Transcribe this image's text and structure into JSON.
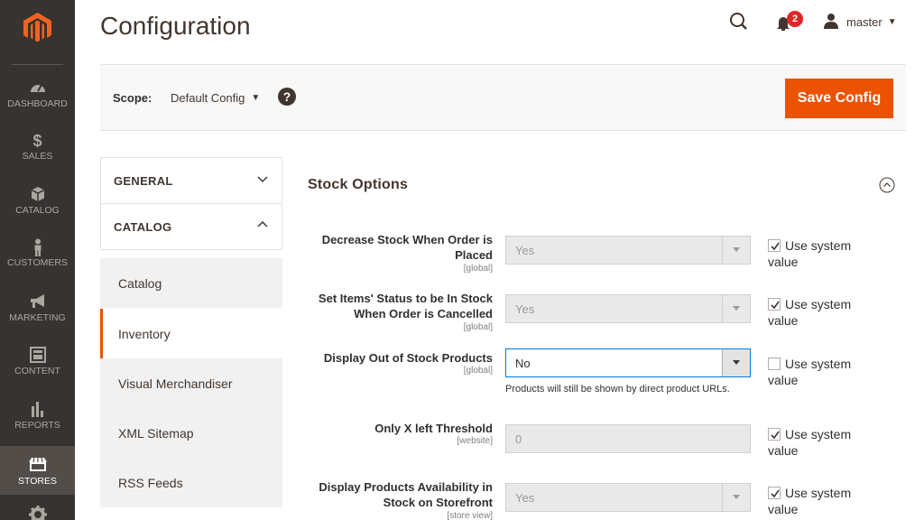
{
  "nav": {
    "items": [
      {
        "key": "dashboard",
        "label": "DASHBOARD",
        "icon": "speedometer-icon"
      },
      {
        "key": "sales",
        "label": "SALES",
        "icon": "dollar-icon"
      },
      {
        "key": "catalog",
        "label": "CATALOG",
        "icon": "box-icon"
      },
      {
        "key": "customers",
        "label": "CUSTOMERS",
        "icon": "person-icon"
      },
      {
        "key": "marketing",
        "label": "MARKETING",
        "icon": "megaphone-icon"
      },
      {
        "key": "content",
        "label": "CONTENT",
        "icon": "layout-icon"
      },
      {
        "key": "reports",
        "label": "REPORTS",
        "icon": "bar-chart-icon"
      },
      {
        "key": "stores",
        "label": "STORES",
        "icon": "store-icon",
        "active": true
      },
      {
        "key": "system",
        "label": "",
        "icon": "gear-icon"
      }
    ],
    "sales_glyph": "$"
  },
  "header": {
    "title": "Configuration",
    "notification_count": "2",
    "user_name": "master"
  },
  "scope": {
    "label": "Scope:",
    "value": "Default Config",
    "help": "?"
  },
  "actions": {
    "save_label": "Save Config"
  },
  "tabs": {
    "groups": [
      {
        "label": "GENERAL",
        "expanded": false
      },
      {
        "label": "CATALOG",
        "expanded": true
      }
    ],
    "items": [
      {
        "label": "Catalog",
        "active": false
      },
      {
        "label": "Inventory",
        "active": true
      },
      {
        "label": "Visual Merchandiser",
        "active": false
      },
      {
        "label": "XML Sitemap",
        "active": false
      },
      {
        "label": "RSS Feeds",
        "active": false
      }
    ]
  },
  "section": {
    "title": "Stock Options",
    "rows": [
      {
        "label_line1": "Decrease Stock When Order is",
        "label_line2": "Placed",
        "scope": "[global]",
        "type": "select",
        "value": "Yes",
        "disabled": true,
        "use_system_label": "Use system",
        "use_system_label2": "value",
        "use_system": true
      },
      {
        "label_line1": "Set Items' Status to be In Stock",
        "label_line2": "When Order is Cancelled",
        "scope": "[global]",
        "type": "select",
        "value": "Yes",
        "disabled": true,
        "use_system_label": "Use system",
        "use_system_label2": "value",
        "use_system": true
      },
      {
        "label_line1": "Display Out of Stock Products",
        "scope": "[global]",
        "type": "select",
        "value": "No",
        "disabled": false,
        "note": "Products will still be shown by direct product URLs.",
        "use_system_label": "Use system",
        "use_system_label2": "value",
        "use_system": false
      },
      {
        "label_line1": "Only X left Threshold",
        "scope": "[website]",
        "type": "input",
        "value": "0",
        "disabled": true,
        "use_system_label": "Use system",
        "use_system_label2": "value",
        "use_system": true
      },
      {
        "label_line1": "Display Products Availability in",
        "label_line2": "Stock on Storefront",
        "scope": "[store view]",
        "type": "select",
        "value": "Yes",
        "disabled": true,
        "use_system_label": "Use system",
        "use_system_label2": "value",
        "use_system": true
      }
    ]
  },
  "colors": {
    "accent": "#eb5202",
    "nav_bg": "#373330",
    "badge": "#e22626",
    "focus": "#007bdb"
  }
}
